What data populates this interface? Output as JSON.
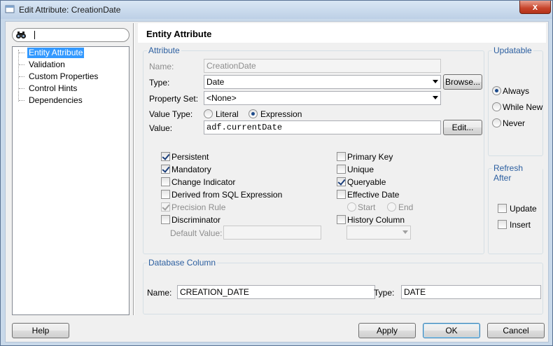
{
  "window": {
    "title": "Edit Attribute: CreationDate",
    "close_glyph": "x"
  },
  "search": {
    "value": ""
  },
  "tree": {
    "items": [
      {
        "label": "Entity Attribute",
        "selected": true
      },
      {
        "label": "Validation",
        "selected": false
      },
      {
        "label": "Custom Properties",
        "selected": false
      },
      {
        "label": "Control Hints",
        "selected": false
      },
      {
        "label": "Dependencies",
        "selected": false
      }
    ]
  },
  "header": {
    "title": "Entity Attribute"
  },
  "attribute_group": {
    "legend": "Attribute",
    "name_label": "Name:",
    "name_value": "CreationDate",
    "type_label": "Type:",
    "type_value": "Date",
    "browse_label": "Browse...",
    "property_set_label": "Property Set:",
    "property_set_value": "<None>",
    "value_type_label": "Value Type:",
    "value_type_literal": "Literal",
    "value_type_expression": "Expression",
    "value_type_selected": "Expression",
    "value_label": "Value:",
    "value_value": "adf.currentDate",
    "edit_label": "Edit...",
    "left_checks": [
      {
        "label": "Persistent",
        "checked": true,
        "disabled": false
      },
      {
        "label": "Mandatory",
        "checked": true,
        "disabled": false
      },
      {
        "label": "Change Indicator",
        "checked": false,
        "disabled": false
      },
      {
        "label": "Derived from SQL Expression",
        "checked": false,
        "disabled": false
      },
      {
        "label": "Precision Rule",
        "checked": true,
        "disabled": true
      },
      {
        "label": "Discriminator",
        "checked": false,
        "disabled": false
      }
    ],
    "default_value_label": "Default Value:",
    "default_value": "",
    "right_checks": [
      {
        "label": "Primary Key",
        "checked": false
      },
      {
        "label": "Unique",
        "checked": false
      },
      {
        "label": "Queryable",
        "checked": true
      },
      {
        "label": "Effective Date",
        "checked": false
      }
    ],
    "start_label": "Start",
    "end_label": "End",
    "history_column_label": "History Column",
    "history_column_checked": false,
    "history_column_value": ""
  },
  "updatable_group": {
    "legend": "Updatable",
    "options": [
      {
        "label": "Always",
        "selected": true
      },
      {
        "label": "While New",
        "selected": false
      },
      {
        "label": "Never",
        "selected": false
      }
    ]
  },
  "refresh_group": {
    "legend": "Refresh After",
    "options": [
      {
        "label": "Update",
        "checked": false
      },
      {
        "label": "Insert",
        "checked": false
      }
    ]
  },
  "database_group": {
    "legend": "Database Column",
    "name_label": "Name:",
    "name_value": "CREATION_DATE",
    "type_label": "Type:",
    "type_value": "DATE"
  },
  "footer": {
    "help_label": "Help",
    "apply_label": "Apply",
    "ok_label": "OK",
    "cancel_label": "Cancel"
  },
  "colors": {
    "accent": "#3399ff",
    "legend_text": "#2c5fa0",
    "close_button": "#c7432a"
  }
}
